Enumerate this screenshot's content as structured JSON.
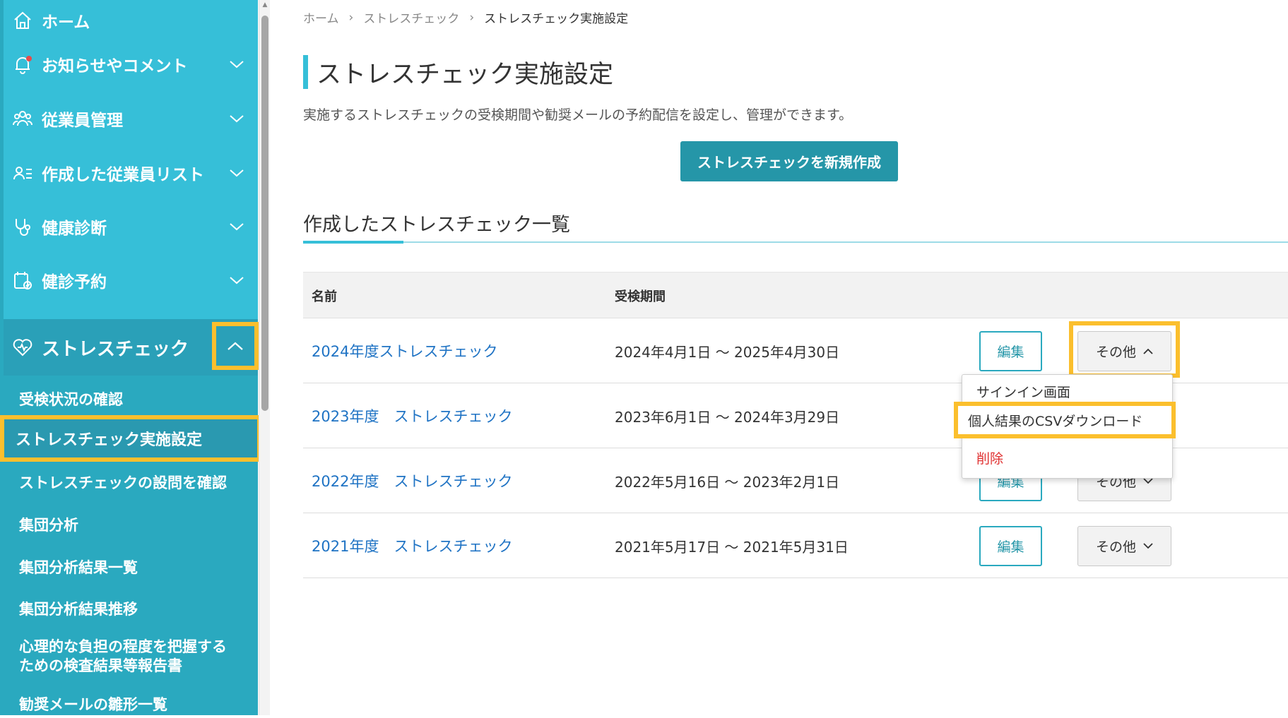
{
  "sidebar": {
    "items": [
      {
        "label": "ホーム",
        "icon": "home-icon"
      },
      {
        "label": "お知らせやコメント",
        "icon": "bell-icon"
      },
      {
        "label": "従業員管理",
        "icon": "users-icon"
      },
      {
        "label": "作成した従業員リスト",
        "icon": "user-list-icon"
      },
      {
        "label": "健康診断",
        "icon": "stethoscope-icon"
      },
      {
        "label": "健診予約",
        "icon": "calendar-check-icon"
      },
      {
        "label": "ストレスチェック",
        "icon": "heart-icon"
      }
    ],
    "submenu": [
      "受検状況の確認",
      "ストレスチェック実施設定",
      "ストレスチェックの設問を確認",
      "集団分析",
      "集団分析結果一覧",
      "集団分析結果推移",
      "心理的な負担の程度を把握する",
      "ための検査結果等報告書",
      "勧奨メールの雛形一覧"
    ]
  },
  "breadcrumb": [
    "ホーム",
    "ストレスチェック",
    "ストレスチェック実施設定"
  ],
  "breadcrumb_separator": "›",
  "page": {
    "title": "ストレスチェック実施設定",
    "description": "実施するストレスチェックの受検期間や勧奨メールの予約配信を設定し、管理ができます。",
    "new_button": "ストレスチェックを新規作成",
    "list_title": "作成したストレスチェック一覧"
  },
  "table": {
    "headers": [
      "名前",
      "受検期間"
    ],
    "edit_label": "編集",
    "other_label": "その他",
    "rows": [
      {
        "name": "2024年度ストレスチェック",
        "period": "2024年4月1日 〜 2025年4月30日"
      },
      {
        "name": "2023年度　ストレスチェック",
        "period": "2023年6月1日 〜 2024年3月29日"
      },
      {
        "name": "2022年度　ストレスチェック",
        "period": "2022年5月16日 〜 2023年2月1日"
      },
      {
        "name": "2021年度　ストレスチェック",
        "period": "2021年5月17日 〜 2021年5月31日"
      }
    ]
  },
  "dropdown": {
    "items": [
      "サインイン画面",
      "個人結果のCSVダウンロード",
      "削除"
    ]
  },
  "colors": {
    "sidebar": "#36bfd8",
    "accent": "#2596a8",
    "highlight": "#fbbf2d",
    "link": "#1f73c4",
    "danger": "#e03232"
  }
}
